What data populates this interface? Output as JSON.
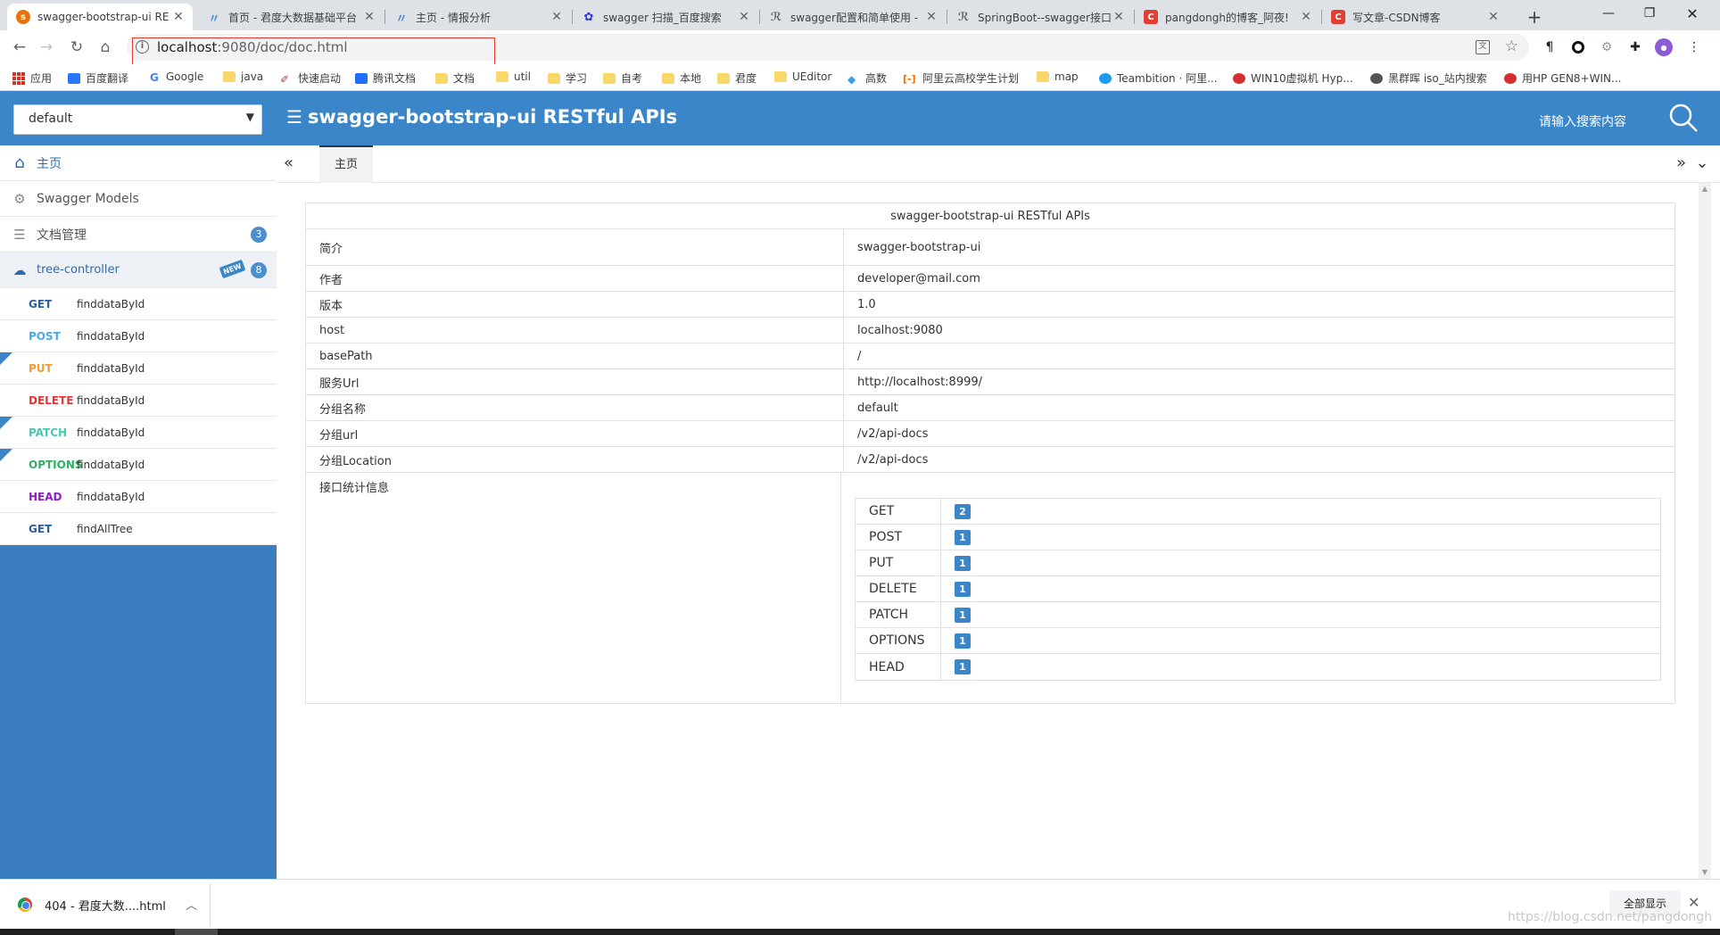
{
  "browser": {
    "tabs": [
      {
        "title": "swagger-bootstrap-ui RE",
        "active": true,
        "icon_color": "#e8710a"
      },
      {
        "title": "首页 - 君度大数据基础平台",
        "active": false,
        "icon_color": "#4a90d9"
      },
      {
        "title": "主页 - 情报分析",
        "active": false,
        "icon_color": "#4a90d9"
      },
      {
        "title": "swagger 扫描_百度搜索",
        "active": false,
        "icon_color": "#2932e1"
      },
      {
        "title": "swagger配置和简单使用 -",
        "active": false,
        "icon_color": "#666666"
      },
      {
        "title": "SpringBoot--swagger接口",
        "active": false,
        "icon_color": "#666666"
      },
      {
        "title": "pangdongh的博客_阿夜!",
        "active": false,
        "icon_color": "#e33e33"
      },
      {
        "title": "写文章-CSDN博客",
        "active": false,
        "icon_color": "#e33e33"
      }
    ],
    "url_host": "localhost",
    "url_rest": ":9080/doc/doc.html",
    "bookmarks": [
      {
        "label": "应用",
        "icon": "apps-icon"
      },
      {
        "label": "百度翻译",
        "icon": "translate-icon",
        "color": "#2878ff"
      },
      {
        "label": "Google",
        "icon": "google-icon",
        "color": "#4285f4"
      },
      {
        "label": "java",
        "icon": "folder-icon"
      },
      {
        "label": "快速启动",
        "icon": "pen-icon",
        "color": "#c0392b"
      },
      {
        "label": "腾讯文档",
        "icon": "tencent-docs-icon",
        "color": "#1e6fff"
      },
      {
        "label": "文档",
        "icon": "folder-icon"
      },
      {
        "label": "util",
        "icon": "folder-icon"
      },
      {
        "label": "学习",
        "icon": "folder-icon"
      },
      {
        "label": "自考",
        "icon": "folder-icon"
      },
      {
        "label": "本地",
        "icon": "folder-icon"
      },
      {
        "label": "君度",
        "icon": "folder-icon"
      },
      {
        "label": "UEditor",
        "icon": "folder-icon"
      },
      {
        "label": "高数",
        "icon": "diamond-icon",
        "color": "#35a0e8"
      },
      {
        "label": "阿里云高校学生计划",
        "icon": "aliyun-icon",
        "color": "#ff6a00"
      },
      {
        "label": "map",
        "icon": "folder-icon"
      },
      {
        "label": "Teambition · 阿里...",
        "icon": "teambition-icon",
        "color": "#1b9aee"
      },
      {
        "label": "WIN10虚拟机 Hyp...",
        "icon": "site-icon",
        "color": "#d32f2f"
      },
      {
        "label": "黑群晖 iso_站内搜索",
        "icon": "site-icon",
        "color": "#555555"
      },
      {
        "label": "用HP GEN8+WIN...",
        "icon": "site-icon",
        "color": "#d32f2f"
      }
    ]
  },
  "app": {
    "group_select": "default",
    "title": "swagger-bootstrap-ui RESTful APIs",
    "search_placeholder": "请输入搜索内容",
    "accent": "#3a86c8"
  },
  "sidebar": {
    "home": "主页",
    "models": "Swagger Models",
    "docs": "文档管理",
    "docs_count": "3",
    "controller": "tree-controller",
    "controller_new": "NEW",
    "controller_count": "8",
    "apis": [
      {
        "method": "GET",
        "path": "finddataById",
        "color": "#2b5f9e",
        "corner": false
      },
      {
        "method": "POST",
        "path": "finddataById",
        "color": "#49a8e8",
        "corner": false
      },
      {
        "method": "PUT",
        "path": "finddataById",
        "color": "#f39c33",
        "corner": true
      },
      {
        "method": "DELETE",
        "path": "finddataById",
        "color": "#e83535",
        "corner": false
      },
      {
        "method": "PATCH",
        "path": "finddataById",
        "color": "#45c8b0",
        "corner": true
      },
      {
        "method": "OPTIONS",
        "path": "finddataById",
        "color": "#31b065",
        "corner": true
      },
      {
        "method": "HEAD",
        "path": "finddataById",
        "color": "#8a21c4",
        "corner": false
      },
      {
        "method": "GET",
        "path": "findAllTree",
        "color": "#2b5f9e",
        "corner": false
      }
    ]
  },
  "main": {
    "tab_label": "主页",
    "doc_caption": "swagger-bootstrap-ui RESTful APIs",
    "rows": [
      {
        "key": "简介",
        "value": "swagger-bootstrap-ui"
      },
      {
        "key": "作者",
        "value": "developer@mail.com"
      },
      {
        "key": "版本",
        "value": "1.0"
      },
      {
        "key": "host",
        "value": "localhost:9080"
      },
      {
        "key": "basePath",
        "value": "/"
      },
      {
        "key": "服务Url",
        "value": "http://localhost:8999/"
      },
      {
        "key": "分组名称",
        "value": "default"
      },
      {
        "key": "分组url",
        "value": "/v2/api-docs"
      },
      {
        "key": "分组Location",
        "value": "/v2/api-docs"
      }
    ],
    "stats_label": "接口统计信息",
    "stats": [
      {
        "method": "GET",
        "count": "2"
      },
      {
        "method": "POST",
        "count": "1"
      },
      {
        "method": "PUT",
        "count": "1"
      },
      {
        "method": "DELETE",
        "count": "1"
      },
      {
        "method": "PATCH",
        "count": "1"
      },
      {
        "method": "OPTIONS",
        "count": "1"
      },
      {
        "method": "HEAD",
        "count": "1"
      }
    ]
  },
  "download_bar": {
    "file": "404 - 君度大数....html",
    "show_all": "全部显示"
  },
  "watermark": "https://blog.csdn.net/pangdongh"
}
